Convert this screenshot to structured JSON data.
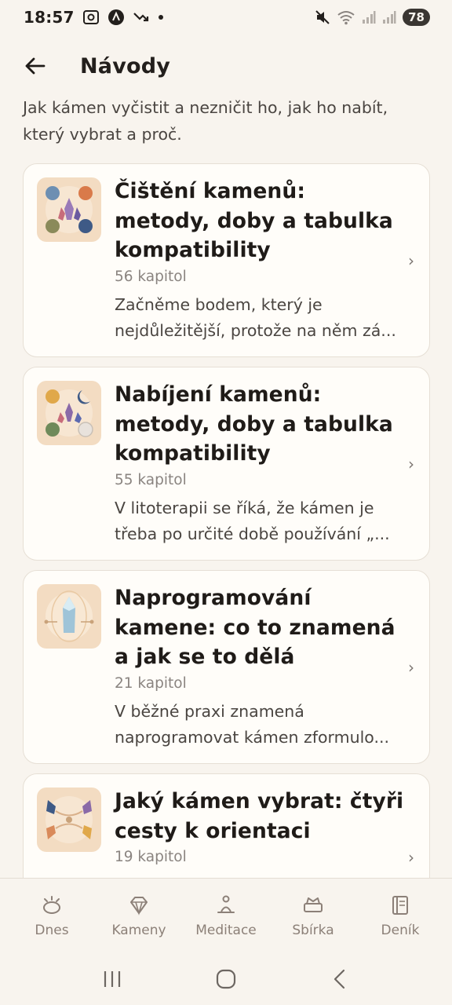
{
  "status_bar": {
    "time": "18:57",
    "battery": "78",
    "icons": [
      "screenshot-icon",
      "app-a-icon",
      "missed-call-icon",
      "dot-icon",
      "mute-icon",
      "wifi-icon",
      "signal-icon",
      "signal-icon"
    ]
  },
  "header": {
    "title": "Návody",
    "back_icon": "arrow-left-icon"
  },
  "intro": "Jak kámen vyčistit a nezničit ho, jak ho nabít, který vybrat a proč.",
  "guides": [
    {
      "title": "Čištění kamenů: metody, doby a tabulka kompatibility",
      "chapters": "56 kapitol",
      "excerpt": "Začněme bodem, který je nejdůležitější, protože na něm zá..."
    },
    {
      "title": "Nabíjení kamenů: metody, doby a tabulka kompatibility",
      "chapters": "55 kapitol",
      "excerpt": "V litoterapii se říká, že kámen je třeba po určité době používání „..."
    },
    {
      "title": "Naprogramování kamene: co to znamená a jak se to dělá",
      "chapters": "21 kapitol",
      "excerpt": "V běžné praxi znamená naprogramovat kámen zformulo..."
    },
    {
      "title": "Jaký kámen vybrat: čtyři cesty k orientaci",
      "chapters": "19 kapitol",
      "excerpt": ""
    }
  ],
  "bottom_nav": [
    {
      "label": "Dnes",
      "icon": "sunrise-icon"
    },
    {
      "label": "Kameny",
      "icon": "gem-icon"
    },
    {
      "label": "Meditace",
      "icon": "meditation-icon"
    },
    {
      "label": "Sbírka",
      "icon": "crown-box-icon"
    },
    {
      "label": "Deník",
      "icon": "journal-icon"
    }
  ],
  "colors": {
    "background": "#f8f4ee",
    "card": "#fffdf9",
    "text": "#231f1c",
    "muted": "#8a8480",
    "nav_icon": "#8c8078"
  }
}
